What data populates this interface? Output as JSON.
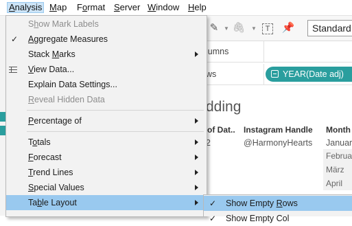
{
  "menubar": {
    "items": [
      {
        "label": "Analysis",
        "key": "A",
        "rest": "nalysis"
      },
      {
        "label": "Map",
        "key": "M",
        "rest": "ap"
      },
      {
        "label": "Format",
        "key": "o",
        "pre": "F",
        "rest": "rmat"
      },
      {
        "label": "Server",
        "key": "S",
        "rest": "erver"
      },
      {
        "label": "Window",
        "key": "W",
        "rest": "indow"
      },
      {
        "label": "Help",
        "key": "H",
        "rest": "elp"
      }
    ]
  },
  "toolbar": {
    "fit_dropdown_value": "Standard"
  },
  "shelves": {
    "columns_label": "Columns",
    "columns_visible": "lumns",
    "rows_visible": "ws",
    "rows_pill": "YEAR(Date adj)"
  },
  "view": {
    "title_visible": "dding",
    "headers": [
      "of Dat..",
      "Instagram Handle",
      "Month"
    ],
    "row1": {
      "date_frag": "2",
      "handle": "@HarmonyHearts",
      "month": "Januar"
    },
    "months": [
      "Februa",
      "März",
      "April"
    ]
  },
  "menu": {
    "items": [
      {
        "label": "Show Mark Labels",
        "u": "h",
        "pre": "S",
        "rest": "ow Mark Labels",
        "disabled": true
      },
      {
        "label": "Aggregate Measures",
        "u": "A",
        "pre": "",
        "rest": "ggregate Measures",
        "checked": true
      },
      {
        "label": "Stack Marks",
        "u": "M",
        "pre": "Stack ",
        "rest": "arks",
        "submenu": true
      },
      {
        "label": "View Data...",
        "u": "V",
        "pre": "",
        "rest": "iew Data...",
        "icon": "view-data-icon"
      },
      {
        "label": "Explain Data Settings...",
        "pre": "Explain Data Settings..."
      },
      {
        "label": "Reveal Hidden Data",
        "u": "R",
        "pre": "",
        "rest": "eveal Hidden Data",
        "disabled": true
      },
      {
        "label": "Percentage of",
        "u": "P",
        "pre": "",
        "rest": "ercentage of",
        "submenu": true
      },
      {
        "label": "Totals",
        "u": "o",
        "pre": "T",
        "rest": "tals",
        "submenu": true
      },
      {
        "label": "Forecast",
        "u": "F",
        "pre": "",
        "rest": "orecast",
        "submenu": true
      },
      {
        "label": "Trend Lines",
        "u": "T",
        "pre": "",
        "rest": "rend Lines",
        "submenu": true
      },
      {
        "label": "Special Values",
        "u": "S",
        "pre": "",
        "rest": "pecial Values",
        "submenu": true
      },
      {
        "label": "Table Layout",
        "u": "b",
        "pre": "Ta",
        "rest": "le Layout",
        "submenu": true,
        "highlighted": true
      }
    ]
  },
  "submenu": {
    "items": [
      {
        "label": "Show Empty Rows",
        "pre": "Show Empty ",
        "u": "R",
        "rest": "ows",
        "checked": true,
        "highlighted": true
      },
      {
        "label": "Show Empty Columns",
        "pre": "Show Empty Col",
        "partial": true
      }
    ]
  },
  "colors": {
    "menu_bg": "#f2f2f2",
    "highlight": "#99c9ef",
    "accent_teal": "#2a9e9e"
  }
}
